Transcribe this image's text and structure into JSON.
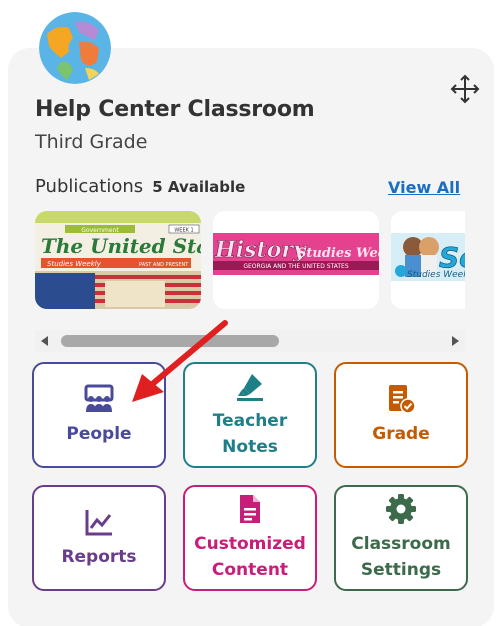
{
  "classroom": {
    "name": "Help Center Classroom",
    "grade": "Third Grade"
  },
  "publications": {
    "label": "Publications",
    "count_text": "5 Available",
    "view_all": "View All",
    "items": [
      {
        "title": "The United States",
        "brand": "Studies Weekly",
        "subtitle": "PAST AND PRESENT",
        "banner": "Government",
        "week": "WEEK 1"
      },
      {
        "title": "History",
        "brand": "Studies Weekly",
        "subtitle": "GEORGIA AND THE UNITED STATES"
      },
      {
        "title": "Sci",
        "brand": "Studies Weekly"
      }
    ]
  },
  "tiles": {
    "people": "People",
    "teacher_notes": "Teacher\nNotes",
    "grade": "Grade",
    "reports": "Reports",
    "customized_content": "Customized\nContent",
    "classroom_settings": "Classroom\nSettings"
  },
  "colors": {
    "people": "#4a4a9a",
    "teacher_notes": "#1f7f86",
    "grade": "#c55a00",
    "reports": "#6a3d8a",
    "customized_content": "#c81d78",
    "classroom_settings": "#3d6a4a",
    "link": "#1a6fc1",
    "annotation_arrow": "#e02020"
  },
  "icons": {
    "avatar": "globe-icon",
    "drag": "move-icon",
    "people": "people-icon",
    "teacher_notes": "highlighter-icon",
    "grade": "grade-document-icon",
    "reports": "line-chart-icon",
    "customized_content": "file-text-icon",
    "classroom_settings": "gear-icon"
  }
}
